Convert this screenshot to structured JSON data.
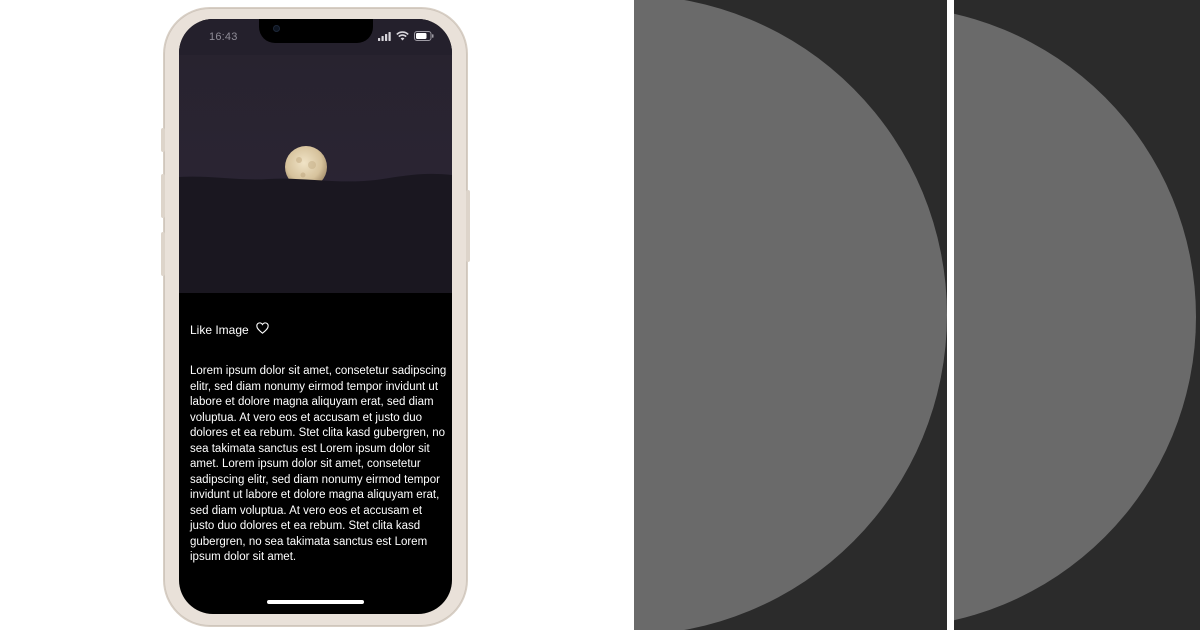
{
  "status_bar": {
    "time": "16:43",
    "wifi_icon": "wifi-icon",
    "signal_icon": "cellular-signal-icon",
    "battery_icon": "battery-icon"
  },
  "hero_image": {
    "subject": "moon-over-hills"
  },
  "like": {
    "label": "Like Image",
    "icon": "heart-outline-icon"
  },
  "content": {
    "paragraph": "Lorem ipsum dolor sit amet, consetetur sadipscing elitr, sed diam nonumy eirmod tempor invidunt ut labore et dolore magna aliquyam erat, sed diam voluptua. At vero eos et accusam et justo duo dolores et ea rebum. Stet clita kasd gubergren, no sea takimata sanctus est Lorem ipsum dolor sit amet. Lorem ipsum dolor sit amet, consetetur sadipscing elitr, sed diam nonumy eirmod tempor invidunt ut labore et dolore magna aliquyam erat, sed diam voluptua. At vero eos et accusam et justo duo dolores et ea rebum. Stet clita kasd gubergren, no sea takimata sanctus est Lorem ipsum dolor sit amet."
  },
  "colors": {
    "screen_background": "#000000",
    "text": "#ffffff",
    "phone_frame": "#e9e1d9",
    "night_sky": "#28232f",
    "moon": "#d9c9a7",
    "panel_background": "#2b2b2b",
    "panel_shape": "#6a6a6a"
  }
}
